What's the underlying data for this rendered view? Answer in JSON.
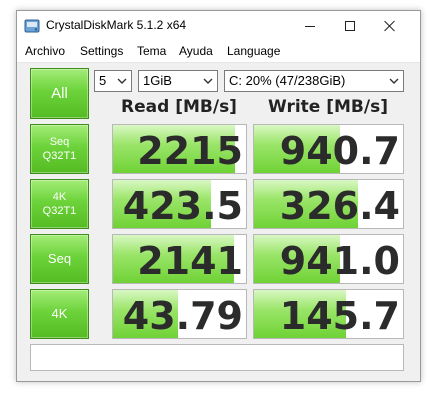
{
  "window": {
    "title": "CrystalDiskMark 5.1.2 x64"
  },
  "menu": [
    "Archivo",
    "Settings",
    "Tema",
    "Ayuda",
    "Language"
  ],
  "controls": {
    "all_label": "All",
    "count_value": "5",
    "size_value": "1GiB",
    "drive_value": "C: 20% (47/238GiB)"
  },
  "headers": {
    "read": "Read [MB/s]",
    "write": "Write [MB/s]"
  },
  "rows": [
    {
      "label_line1": "Seq",
      "label_line2": "Q32T1",
      "read": "2215",
      "read_fill": 0.92,
      "write": "940.7",
      "write_fill": 0.58
    },
    {
      "label_line1": "4K",
      "label_line2": "Q32T1",
      "read": "423.5",
      "read_fill": 0.74,
      "write": "326.4",
      "write_fill": 0.7
    },
    {
      "label_line1": "Seq",
      "label_line2": "",
      "read": "2141",
      "read_fill": 0.91,
      "write": "941.0",
      "write_fill": 0.58
    },
    {
      "label_line1": "4K",
      "label_line2": "",
      "read": "43.79",
      "read_fill": 0.49,
      "write": "145.7",
      "write_fill": 0.62
    }
  ],
  "comment": "",
  "colors": {
    "accent_green": "#54bc22",
    "fill_green": "#6fd235"
  }
}
